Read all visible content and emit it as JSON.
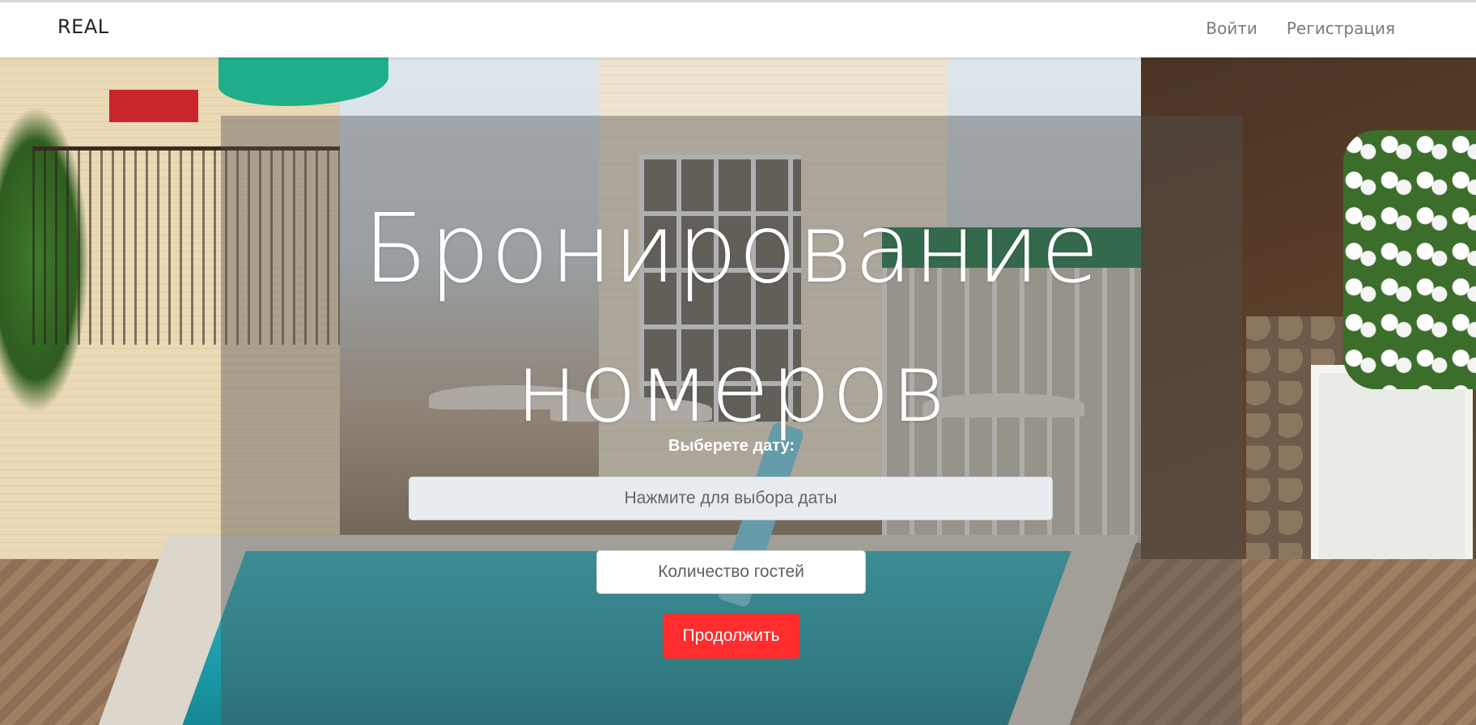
{
  "navbar": {
    "brand": "REAL",
    "links": {
      "login": "Войти",
      "register": "Регистрация"
    }
  },
  "hero": {
    "title": "Бронирование номеров",
    "date_label": "Выберете дату:",
    "date_input": {
      "placeholder": "Нажмите для выбора даты",
      "value": ""
    },
    "guests_button": "Количество гостей",
    "continue_button": "Продолжить"
  },
  "colors": {
    "accent": "#ff2d2d",
    "navbar_bg": "#ffffff",
    "overlay": "rgba(80, 80, 80, 0.42)",
    "input_bg": "#e9ecef"
  }
}
